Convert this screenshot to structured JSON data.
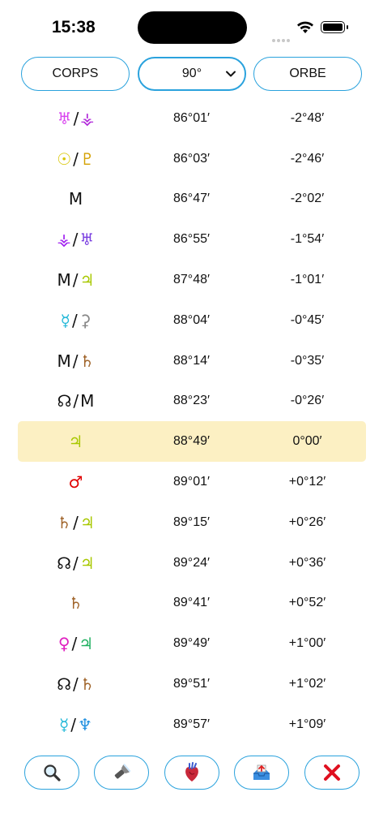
{
  "status": {
    "time": "15:38"
  },
  "header": {
    "corps_label": "CORPS",
    "angle_value": "90°",
    "orbe_label": "ORBE"
  },
  "rows": [
    {
      "parts": [
        {
          "sym": "♅",
          "color": "#d946ef"
        },
        {
          "sym": "⚶",
          "color": "#b026d9"
        }
      ],
      "position": "86°01′",
      "orbe": "-2°48′"
    },
    {
      "parts": [
        {
          "sym": "☉",
          "color": "#d8c500"
        },
        {
          "sym": "♇",
          "color": "#d4a000"
        }
      ],
      "position": "86°03′",
      "orbe": "-2°46′"
    },
    {
      "parts": [
        {
          "sym": "M",
          "color": "#111111"
        }
      ],
      "position": "86°47′",
      "orbe": "-2°02′"
    },
    {
      "parts": [
        {
          "sym": "⚶",
          "color": "#a020f0"
        },
        {
          "sym": "♅",
          "color": "#7a3fe0"
        }
      ],
      "position": "86°55′",
      "orbe": "-1°54′"
    },
    {
      "parts": [
        {
          "sym": "M",
          "color": "#111111"
        },
        {
          "sym": "♃",
          "color": "#a8c800"
        }
      ],
      "position": "87°48′",
      "orbe": "-1°01′"
    },
    {
      "parts": [
        {
          "sym": "☿",
          "color": "#22b8d8"
        },
        {
          "sym": "⚳",
          "color": "#888888"
        }
      ],
      "position": "88°04′",
      "orbe": "-0°45′"
    },
    {
      "parts": [
        {
          "sym": "M",
          "color": "#111111"
        },
        {
          "sym": "♄",
          "color": "#a0642a"
        }
      ],
      "position": "88°14′",
      "orbe": "-0°35′"
    },
    {
      "parts": [
        {
          "sym": "☊",
          "color": "#111111"
        },
        {
          "sym": "M",
          "color": "#111111"
        }
      ],
      "position": "88°23′",
      "orbe": "-0°26′"
    },
    {
      "parts": [
        {
          "sym": "♃",
          "color": "#a8c800"
        }
      ],
      "position": "88°49′",
      "orbe": "0°00′",
      "highlight": true
    },
    {
      "parts": [
        {
          "sym": "♂",
          "color": "#e00000"
        }
      ],
      "position": "89°01′",
      "orbe": "+0°12′"
    },
    {
      "parts": [
        {
          "sym": "♄",
          "color": "#a0642a"
        },
        {
          "sym": "♃",
          "color": "#a8c800"
        }
      ],
      "position": "89°15′",
      "orbe": "+0°26′"
    },
    {
      "parts": [
        {
          "sym": "☊",
          "color": "#111111"
        },
        {
          "sym": "♃",
          "color": "#a8c800"
        }
      ],
      "position": "89°24′",
      "orbe": "+0°36′"
    },
    {
      "parts": [
        {
          "sym": "♄",
          "color": "#a0642a"
        }
      ],
      "position": "89°41′",
      "orbe": "+0°52′"
    },
    {
      "parts": [
        {
          "sym": "♀",
          "color": "#e020c0"
        },
        {
          "sym": "♃",
          "color": "#20b060"
        }
      ],
      "position": "89°49′",
      "orbe": "+1°00′"
    },
    {
      "parts": [
        {
          "sym": "☊",
          "color": "#111111"
        },
        {
          "sym": "♄",
          "color": "#a0642a"
        }
      ],
      "position": "89°51′",
      "orbe": "+1°02′"
    },
    {
      "parts": [
        {
          "sym": "☿",
          "color": "#22b8d8"
        },
        {
          "sym": "♆",
          "color": "#2090e0"
        }
      ],
      "position": "89°57′",
      "orbe": "+1°09′"
    }
  ],
  "toolbar": {
    "buttons": [
      {
        "name": "search-button",
        "icon": "magnifier-icon"
      },
      {
        "name": "flashlight-button",
        "icon": "flashlight-icon"
      },
      {
        "name": "heart-button",
        "icon": "anatomical-heart-icon"
      },
      {
        "name": "inbox-button",
        "icon": "inbox-tray-icon"
      },
      {
        "name": "close-button",
        "icon": "red-x-icon"
      }
    ]
  },
  "colors": {
    "accent": "#2aa2dd",
    "highlight": "#fcf0c3",
    "close": "#e01020"
  }
}
